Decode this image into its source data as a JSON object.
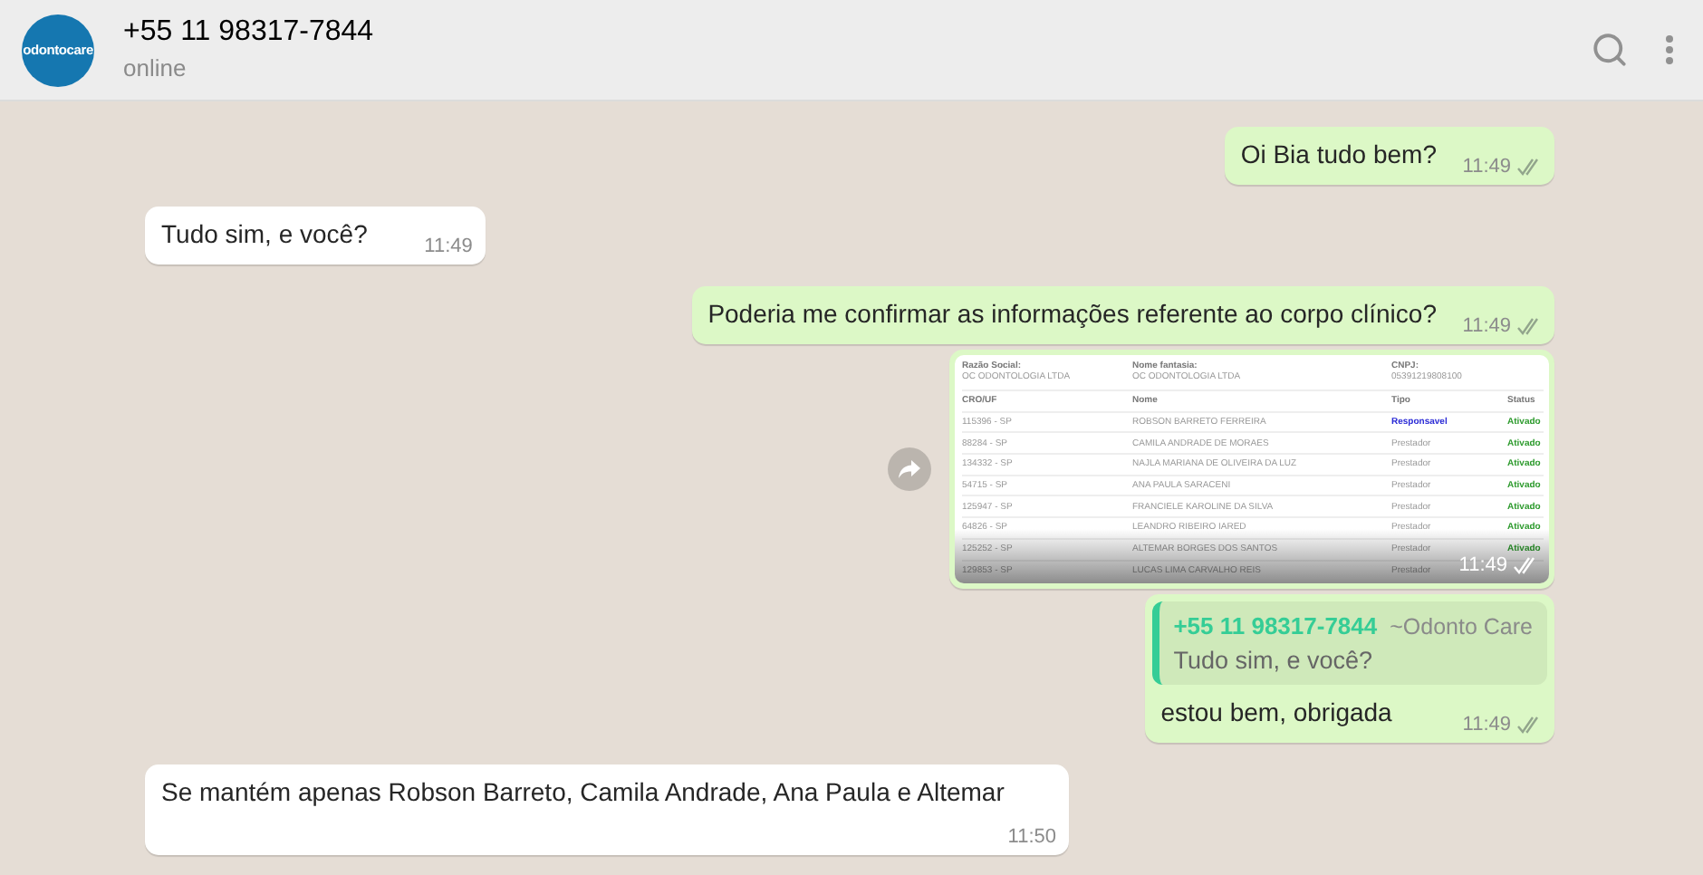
{
  "header": {
    "avatar_text": "odontocare",
    "title": "+55 11 98317-7844",
    "status": "online"
  },
  "messages": [
    {
      "kind": "text",
      "outgoing": true,
      "text": "Oi Bia tudo bem?",
      "time": "11:49",
      "read": false
    },
    {
      "kind": "text",
      "outgoing": false,
      "text": "Tudo sim, e você?",
      "time": "11:49"
    },
    {
      "kind": "text",
      "outgoing": true,
      "text": "Poderia me confirmar as informações referente ao corpo clínico?",
      "time": "11:49",
      "read": false
    },
    {
      "kind": "image",
      "outgoing": true,
      "time": "11:49",
      "read": false,
      "document": {
        "fields": [
          {
            "label": "Razão Social:",
            "value": "OC ODONTOLOGIA LTDA"
          },
          {
            "label": "Nome fantasia:",
            "value": "OC ODONTOLOGIA LTDA"
          },
          {
            "label": "CNPJ:",
            "value": "05391219808100"
          }
        ],
        "columns": [
          "CRO/UF",
          "Nome",
          "Tipo",
          "Status"
        ],
        "rows": [
          {
            "cro": "115396 - SP",
            "name": "ROBSON BARRETO FERREIRA",
            "type": "Responsavel",
            "highlighted": true,
            "status": "Ativado"
          },
          {
            "cro": "88284 - SP",
            "name": "CAMILA ANDRADE DE MORAES",
            "type": "Prestador",
            "highlighted": false,
            "status": "Ativado"
          },
          {
            "cro": "134332 - SP",
            "name": "NAJLA MARIANA DE OLIVEIRA DA LUZ",
            "type": "Prestador",
            "highlighted": false,
            "status": "Ativado"
          },
          {
            "cro": "54715 - SP",
            "name": "ANA PAULA SARACENI",
            "type": "Prestador",
            "highlighted": false,
            "status": "Ativado"
          },
          {
            "cro": "125947 - SP",
            "name": "FRANCIELE KAROLINE DA SILVA",
            "type": "Prestador",
            "highlighted": false,
            "status": "Ativado"
          },
          {
            "cro": "64826 - SP",
            "name": "LEANDRO RIBEIRO IARED",
            "type": "Prestador",
            "highlighted": false,
            "status": "Ativado"
          },
          {
            "cro": "125252 - SP",
            "name": "ALTEMAR BORGES DOS SANTOS",
            "type": "Prestador",
            "highlighted": false,
            "status": "Ativado"
          },
          {
            "cro": "129853 - SP",
            "name": "LUCAS LIMA CARVALHO REIS",
            "type": "Prestador",
            "highlighted": false
          }
        ]
      }
    },
    {
      "kind": "reply",
      "outgoing": true,
      "quote": {
        "author": "+55 11 98317-7844",
        "author_name": "~Odonto Care",
        "text": "Tudo sim, e você?"
      },
      "text": "estou bem, obrigada",
      "time": "11:49",
      "read": false
    },
    {
      "kind": "text",
      "outgoing": false,
      "text": "Se mantém apenas Robson Barreto, Camila Andrade, Ana Paula e Altemar",
      "time": "11:50"
    }
  ]
}
